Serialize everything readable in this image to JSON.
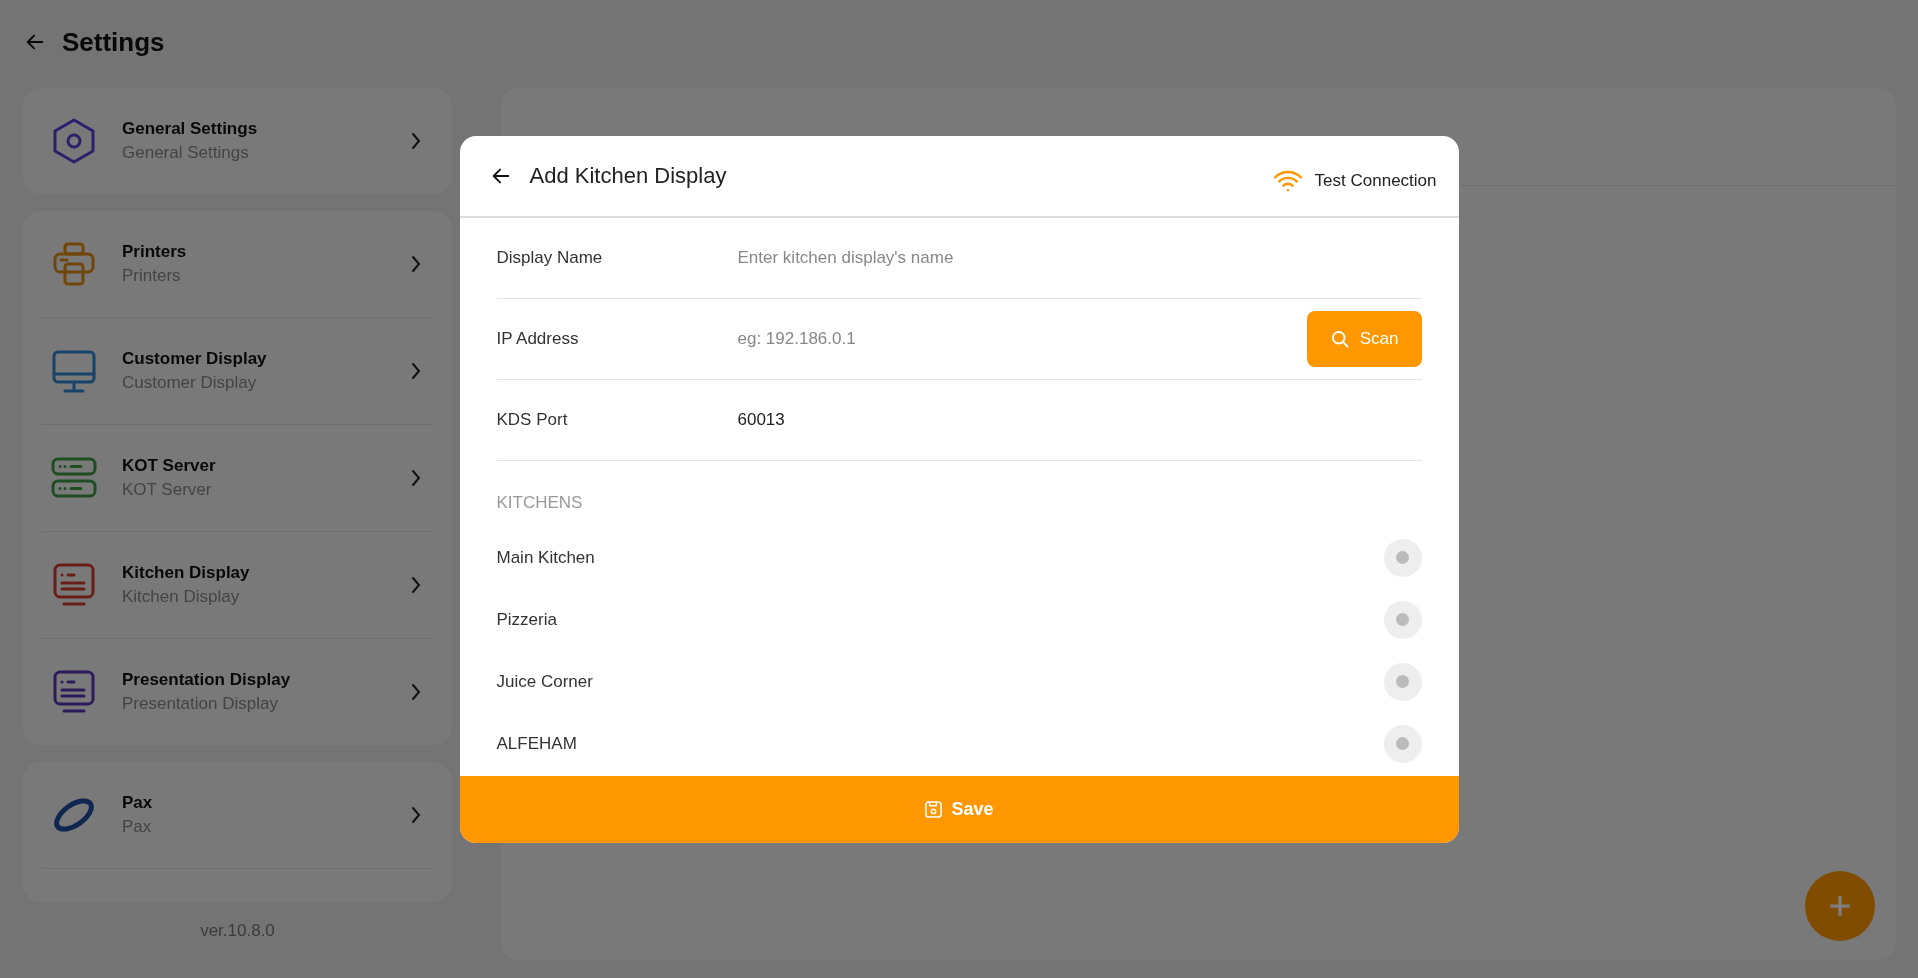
{
  "header": {
    "title": "Settings"
  },
  "sidebar": {
    "sections": [
      {
        "items": [
          {
            "title": "General Settings",
            "subtitle": "General Settings"
          }
        ]
      },
      {
        "items": [
          {
            "title": "Printers",
            "subtitle": "Printers"
          },
          {
            "title": "Customer Display",
            "subtitle": "Customer Display"
          },
          {
            "title": "KOT Server",
            "subtitle": "KOT Server"
          },
          {
            "title": "Kitchen Display",
            "subtitle": "Kitchen Display"
          },
          {
            "title": "Presentation Display",
            "subtitle": "Presentation Display"
          }
        ]
      },
      {
        "items": [
          {
            "title": "Pax",
            "subtitle": "Pax"
          }
        ]
      }
    ],
    "version": "ver.10.8.0"
  },
  "dialog": {
    "title": "Add Kitchen Display",
    "test_connection": "Test Connection",
    "fields": [
      {
        "label": "Display Name",
        "placeholder": "Enter kitchen display's name"
      },
      {
        "label": "IP Address",
        "placeholder": "eg: 192.186.0.1",
        "action": "Scan"
      },
      {
        "label": "KDS Port",
        "value": "60013"
      }
    ],
    "section_label": "KITCHENS",
    "kitchens": [
      {
        "name": "Main Kitchen",
        "selected": false
      },
      {
        "name": "Pizzeria",
        "selected": false
      },
      {
        "name": "Juice Corner",
        "selected": false
      },
      {
        "name": "ALFEHAM",
        "selected": false
      }
    ],
    "save": "Save"
  }
}
